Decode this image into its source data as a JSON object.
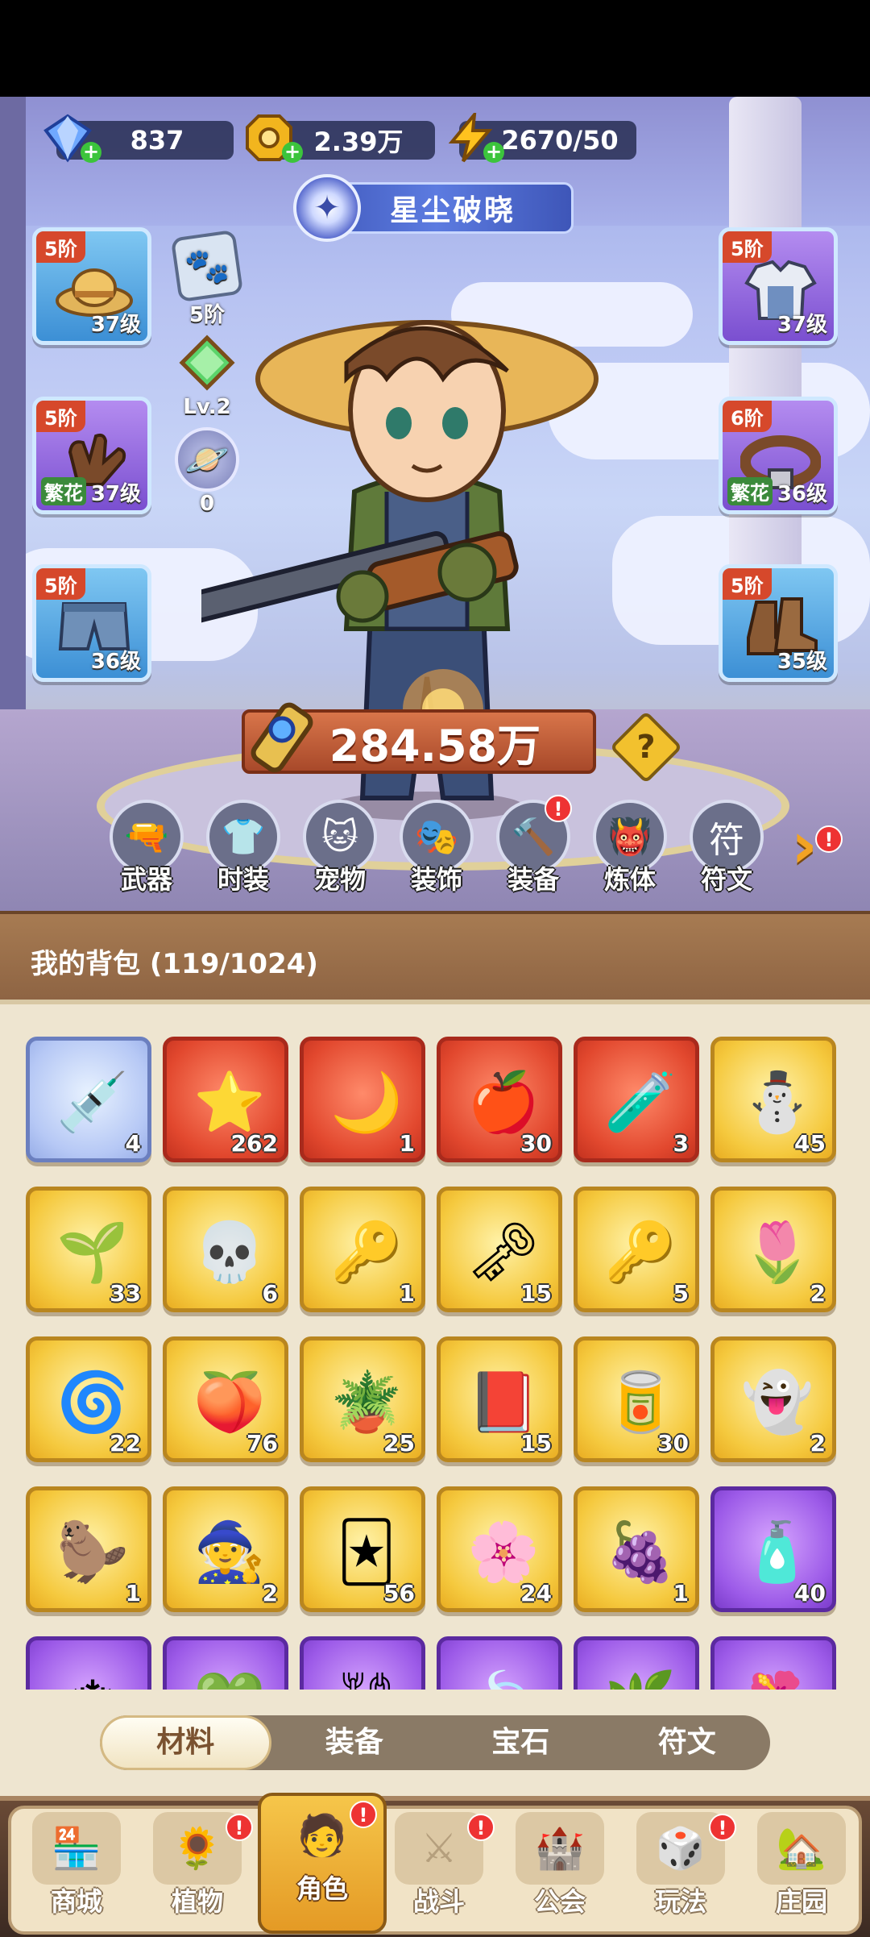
{
  "currencies": {
    "gems": "837",
    "gold": "2.39万",
    "energy": "2670/50"
  },
  "title_banner": "星尘破晓",
  "slots": {
    "hat": {
      "tier": "5阶",
      "level": "37级"
    },
    "gloves": {
      "tier": "5阶",
      "tag": "繁花",
      "level": "37级"
    },
    "pants": {
      "tier": "5阶",
      "level": "36级"
    },
    "clothes": {
      "tier": "5阶",
      "level": "37级"
    },
    "belt": {
      "tier": "6阶",
      "tag": "繁花",
      "level": "36级"
    },
    "boots": {
      "tier": "5阶",
      "level": "35级"
    }
  },
  "minis": {
    "badge_tier": "5阶",
    "gem_level": "Lv.2",
    "orb_count": "0"
  },
  "power": "284.58万",
  "help_symbol": "?",
  "functions": [
    "武器",
    "时装",
    "宠物",
    "装饰",
    "装备",
    "炼体",
    "符文"
  ],
  "backpack": {
    "title": "我的背包 (119/1024)",
    "items": [
      {
        "rarity": "blue",
        "icon": "syringe-icon",
        "count": "4"
      },
      {
        "rarity": "red",
        "icon": "star-crystal-icon",
        "count": "262"
      },
      {
        "rarity": "red",
        "icon": "moon-star-icon",
        "count": "1"
      },
      {
        "rarity": "red",
        "icon": "red-potion-icon",
        "count": "30"
      },
      {
        "rarity": "red",
        "icon": "green-canister-icon",
        "count": "3"
      },
      {
        "rarity": "gold",
        "icon": "snowman-icon",
        "count": "45"
      },
      {
        "rarity": "gold",
        "icon": "seed-icon",
        "count": "33"
      },
      {
        "rarity": "gold",
        "icon": "skull-scroll-icon",
        "count": "6"
      },
      {
        "rarity": "gold",
        "icon": "ruby-key-icon",
        "count": "1"
      },
      {
        "rarity": "gold",
        "icon": "gold-key-icon",
        "count": "15"
      },
      {
        "rarity": "gold",
        "icon": "green-key-icon",
        "count": "5"
      },
      {
        "rarity": "gold",
        "icon": "golden-bulb-icon",
        "count": "2"
      },
      {
        "rarity": "gold",
        "icon": "rune-stone-icon",
        "count": "22"
      },
      {
        "rarity": "gold",
        "icon": "orange-potion-icon",
        "count": "76"
      },
      {
        "rarity": "gold",
        "icon": "flower-pot-icon",
        "count": "25"
      },
      {
        "rarity": "gold",
        "icon": "purple-book-icon",
        "count": "15"
      },
      {
        "rarity": "gold",
        "icon": "tin-can-icon",
        "count": "30"
      },
      {
        "rarity": "gold",
        "icon": "ghost-piece-icon",
        "count": "2"
      },
      {
        "rarity": "gold",
        "icon": "capybara-piece-icon",
        "count": "1"
      },
      {
        "rarity": "gold",
        "icon": "wizard-piece-icon",
        "count": "2"
      },
      {
        "rarity": "gold",
        "icon": "card-icon",
        "count": "56"
      },
      {
        "rarity": "gold",
        "icon": "flower-emblem-icon",
        "count": "24"
      },
      {
        "rarity": "gold",
        "icon": "grape-icon",
        "count": "1"
      },
      {
        "rarity": "purple",
        "icon": "purple-potion-icon",
        "count": "40"
      },
      {
        "rarity": "purple",
        "icon": "ice-crystal-icon",
        "count": ""
      },
      {
        "rarity": "purple",
        "icon": "green-gem-icon",
        "count": ""
      },
      {
        "rarity": "purple",
        "icon": "chain-icon",
        "count": ""
      },
      {
        "rarity": "purple",
        "icon": "leaf-icon",
        "count": ""
      },
      {
        "rarity": "purple",
        "icon": "herb-icon",
        "count": ""
      },
      {
        "rarity": "purple",
        "icon": "flower-icon",
        "count": ""
      }
    ]
  },
  "tabs": [
    {
      "label": "材料",
      "active": true
    },
    {
      "label": "装备",
      "active": false
    },
    {
      "label": "宝石",
      "active": false
    },
    {
      "label": "符文",
      "active": false
    }
  ],
  "nav": [
    {
      "label": "商城",
      "icon": "shop-icon",
      "badge": false,
      "active": false
    },
    {
      "label": "植物",
      "icon": "plant-icon",
      "badge": true,
      "active": false
    },
    {
      "label": "角色",
      "icon": "character-icon",
      "badge": true,
      "active": true
    },
    {
      "label": "战斗",
      "icon": "battle-icon",
      "badge": true,
      "active": false
    },
    {
      "label": "公会",
      "icon": "guild-icon",
      "badge": false,
      "active": false
    },
    {
      "label": "玩法",
      "icon": "gameplay-icon",
      "badge": true,
      "active": false
    },
    {
      "label": "庄园",
      "icon": "manor-icon",
      "badge": false,
      "active": false
    }
  ],
  "badge_symbol": "!",
  "colors": {
    "gold_frame": "#b9861f",
    "red_frame": "#a82a1c",
    "purple_frame": "#5b2aa0",
    "badge_red": "#e33"
  }
}
